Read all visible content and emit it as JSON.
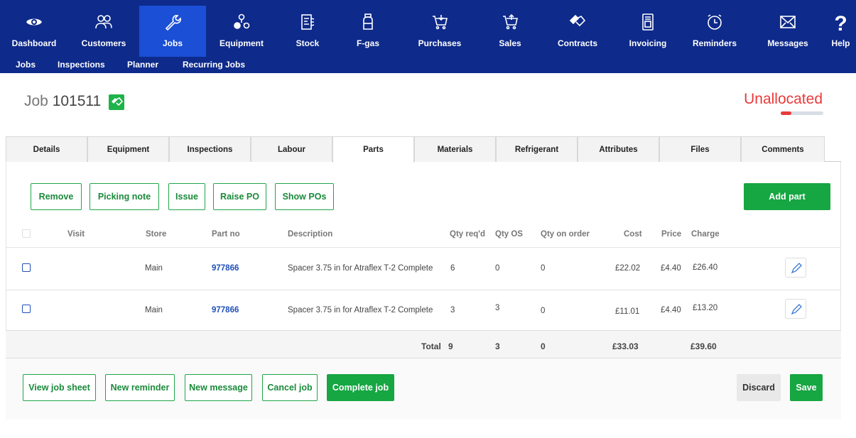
{
  "nav": {
    "items": [
      {
        "label": "Dashboard",
        "icon": "eye-icon"
      },
      {
        "label": "Customers",
        "icon": "people-icon"
      },
      {
        "label": "Jobs",
        "icon": "wrench-icon"
      },
      {
        "label": "Equipment",
        "icon": "equipment-icon"
      },
      {
        "label": "Stock",
        "icon": "stock-icon"
      },
      {
        "label": "F-gas",
        "icon": "gas-cylinder-icon"
      },
      {
        "label": "Purchases",
        "icon": "basket-in-icon"
      },
      {
        "label": "Sales",
        "icon": "basket-out-icon"
      },
      {
        "label": "Contracts",
        "icon": "handshake-icon"
      },
      {
        "label": "Invoicing",
        "icon": "invoice-icon"
      },
      {
        "label": "Reminders",
        "icon": "alarm-clock-icon"
      },
      {
        "label": "Messages",
        "icon": "envelope-icon"
      },
      {
        "label": "Help",
        "icon": "question-icon"
      }
    ],
    "active": "Jobs"
  },
  "subnav": [
    "Jobs",
    "Inspections",
    "Planner",
    "Recurring Jobs"
  ],
  "job": {
    "prefix": "Job",
    "number": "101511",
    "status": "Unallocated",
    "status_color": "#e83a3a"
  },
  "tabs": [
    "Details",
    "Equipment",
    "Inspections",
    "Labour",
    "Parts",
    "Materials",
    "Refrigerant",
    "Attributes",
    "Files",
    "Comments"
  ],
  "active_tab": "Parts",
  "actions": {
    "remove": "Remove",
    "picking_note": "Picking note",
    "issue": "Issue",
    "raise_po": "Raise PO",
    "show_pos": "Show POs",
    "add_part": "Add part"
  },
  "table": {
    "headers": {
      "visit": "Visit",
      "store": "Store",
      "part_no": "Part no",
      "description": "Description",
      "qty_reqd": "Qty req'd",
      "qty_os": "Qty OS",
      "qty_on_order": "Qty on order",
      "cost": "Cost",
      "price": "Price",
      "charge": "Charge"
    },
    "rows": [
      {
        "store": "Main",
        "part_no": "977866",
        "description": "Spacer 3.75 in for Atraflex T-2 Complete",
        "qty_reqd": "6",
        "qty_os": "0",
        "qty_on_order": "0",
        "cost": "£22.02",
        "price": "£4.40",
        "charge": "£26.40"
      },
      {
        "store": "Main",
        "part_no": "977866",
        "description": "Spacer 3.75 in for Atraflex T-2 Complete",
        "qty_reqd": "3",
        "qty_os": "3",
        "qty_on_order": "0",
        "cost": "£11.01",
        "price": "£4.40",
        "charge": "£13.20"
      }
    ],
    "total": {
      "label": "Total",
      "qty_reqd": "9",
      "qty_os": "3",
      "qty_on_order": "0",
      "cost": "£33.03",
      "charge": "£39.60"
    }
  },
  "footer": {
    "view_job_sheet": "View job sheet",
    "new_reminder": "New reminder",
    "new_message": "New message",
    "cancel_job": "Cancel job",
    "complete_job": "Complete job",
    "discard": "Discard",
    "save": "Save"
  }
}
